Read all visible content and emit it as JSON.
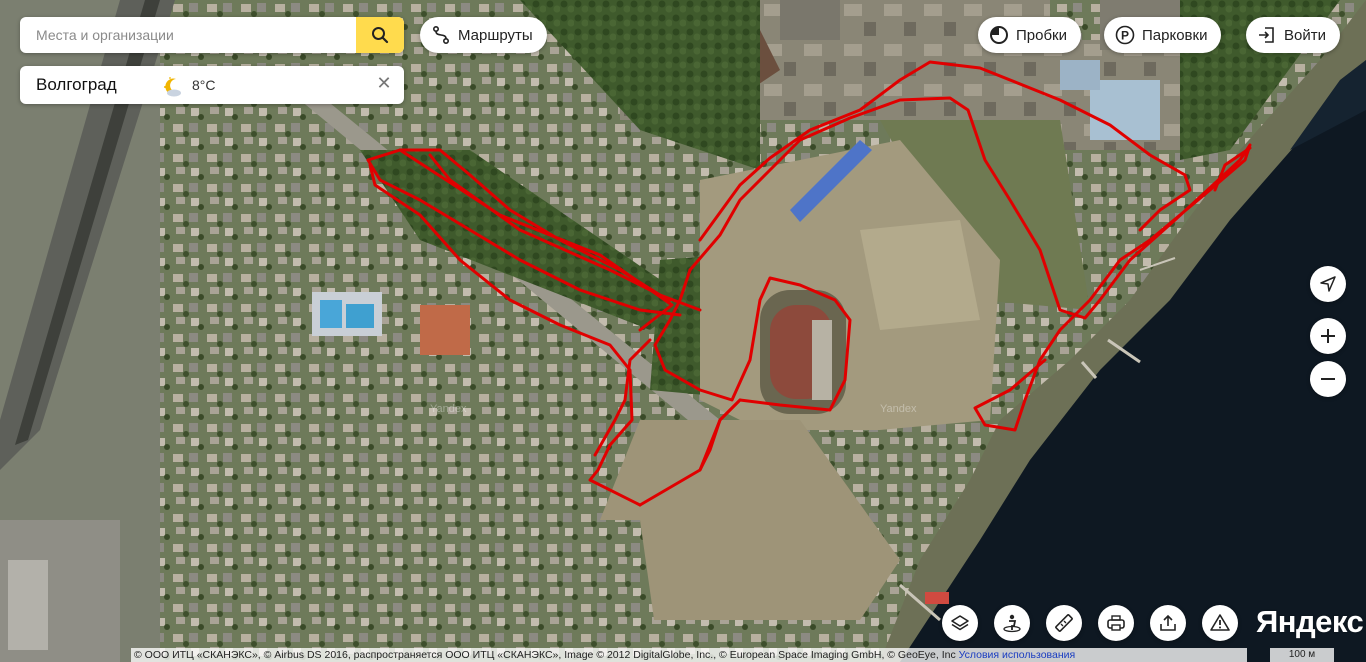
{
  "search": {
    "placeholder": "Места и организации"
  },
  "top_buttons": {
    "routes": "Маршруты",
    "traffic": "Пробки",
    "parking": "Парковки",
    "login": "Войти"
  },
  "weather": {
    "city": "Волгоград",
    "temperature": "8°C"
  },
  "watermark": "Yandex",
  "logo": "Яндекс",
  "copyright": {
    "text": "© ООО ИТЦ «СКАНЭКС», © Airbus DS 2016, распространяется ООО ИТЦ «СКАНЭКС», Image © 2012 DigitalGlobe, Inc., © European Space Imaging GmbH, © GeoEye, Inc ",
    "terms": "Условия использования"
  },
  "scale": "100 м",
  "icons": [
    "search-icon",
    "routes-icon",
    "traffic-icon",
    "parking-icon",
    "login-icon",
    "weather-moon-icon",
    "close-icon",
    "locate-icon",
    "zoom-in-icon",
    "zoom-out-icon",
    "layers-icon",
    "panorama-icon",
    "ruler-icon",
    "print-icon",
    "share-icon",
    "report-icon"
  ],
  "colors": {
    "route": "#e00000",
    "search_button": "#ffdb4d",
    "water": "#0e1822"
  }
}
